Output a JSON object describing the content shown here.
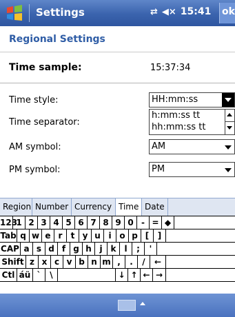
{
  "titlebar": {
    "app_title": "Settings",
    "connectivity_icon": "connectivity-icon",
    "volume_icon": "speaker-muted-icon",
    "time": "15:41",
    "ok_label": "ok"
  },
  "header": {
    "title": "Regional Settings"
  },
  "time_sample": {
    "label": "Time sample:",
    "value": "15:37:34"
  },
  "time_style": {
    "label": "Time style:",
    "value": "HH:mm:ss"
  },
  "time_separator": {
    "label": "Time separator:",
    "options": [
      "h:mm:ss tt",
      "hh:mm:ss tt"
    ]
  },
  "am_symbol": {
    "label": "AM symbol:",
    "value": "AM"
  },
  "pm_symbol": {
    "label": "PM symbol:",
    "value": "PM"
  },
  "tabs": [
    {
      "label": "Region"
    },
    {
      "label": "Number"
    },
    {
      "label": "Currency"
    },
    {
      "label": "Time",
      "active": true
    },
    {
      "label": "Date"
    }
  ],
  "keyboard": {
    "rows": [
      [
        "123",
        "1",
        "2",
        "3",
        "4",
        "5",
        "6",
        "7",
        "8",
        "9",
        "0",
        "-",
        "=",
        "◆"
      ],
      [
        "Tab",
        "q",
        "w",
        "e",
        "r",
        "t",
        "y",
        "u",
        "i",
        "o",
        "p",
        "[",
        "]"
      ],
      [
        "CAP",
        "a",
        "s",
        "d",
        "f",
        "g",
        "h",
        "j",
        "k",
        "l",
        ";",
        "'"
      ],
      [
        "Shift",
        "z",
        "x",
        "c",
        "v",
        "b",
        "n",
        "m",
        ",",
        ".",
        "/",
        "←"
      ],
      [
        "Ctl",
        "áü",
        "`",
        "\\",
        "",
        "↓",
        "↑",
        "←",
        "→"
      ]
    ]
  },
  "colors": {
    "accent": "#3a63ad",
    "header_text": "#2f5da6"
  }
}
